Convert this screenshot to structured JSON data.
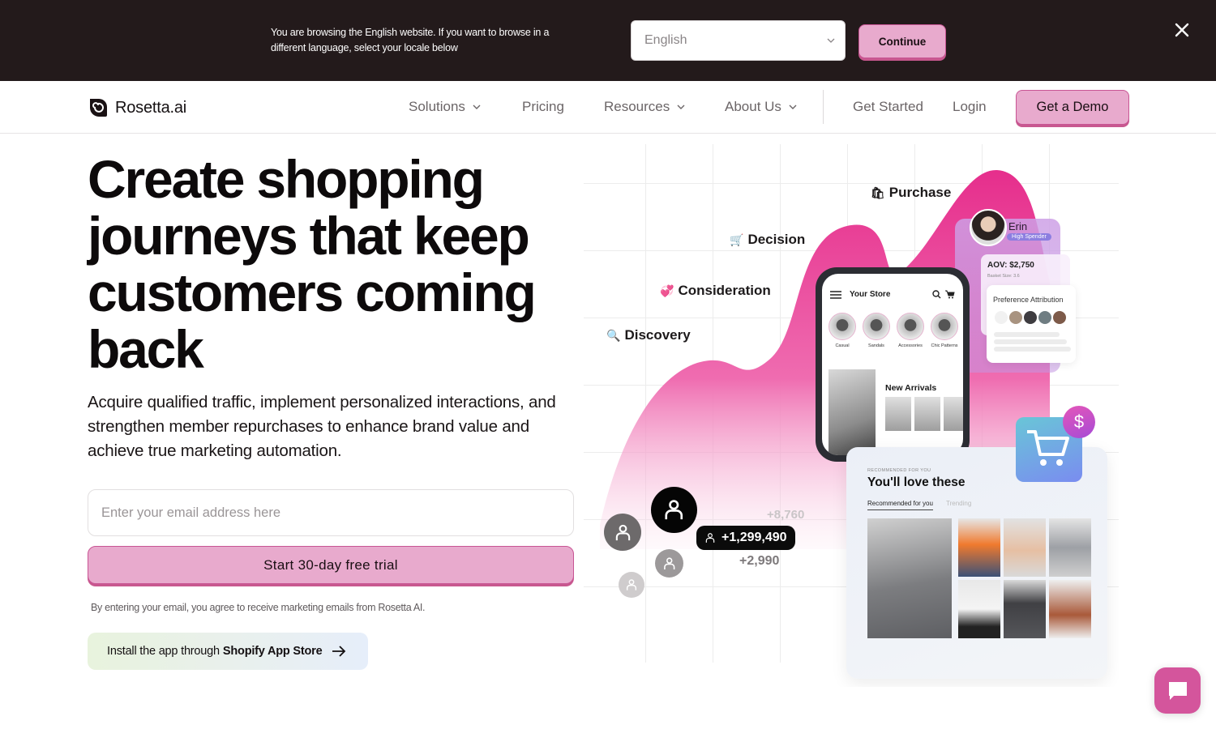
{
  "locale_banner": {
    "message": "You are browsing the English website. If you want to browse in a different language, select your locale below",
    "selected_locale": "English",
    "continue_label": "Continue",
    "close_icon": "close-icon"
  },
  "nav": {
    "brand": "Rosetta.ai",
    "items": [
      {
        "label": "Solutions",
        "dropdown": true
      },
      {
        "label": "Pricing",
        "dropdown": false
      },
      {
        "label": "Resources",
        "dropdown": true
      },
      {
        "label": "About Us",
        "dropdown": true
      }
    ],
    "get_started": "Get Started",
    "login": "Login",
    "demo": "Get a Demo"
  },
  "hero": {
    "title_lines": [
      "Create shopping",
      "journeys that keep",
      "customers coming",
      "back"
    ],
    "subtitle": "Acquire qualified traffic, implement personalized interactions, and strengthen member repurchases to enhance brand value and achieve true marketing automation.",
    "email_placeholder": "Enter your email address here",
    "email_value": "",
    "trial_button": "Start 30-day free trial",
    "consent": "By entering your email, you agree to receive marketing emails from Rosetta AI.",
    "shopify_prefix": "Install the app through",
    "shopify_bold": "Shopify App Store"
  },
  "illustration": {
    "stages": [
      {
        "label": "Discovery",
        "icon": "magnifier-icon",
        "glyph": "🔍"
      },
      {
        "label": "Consideration",
        "icon": "heart-icon",
        "glyph": "💞"
      },
      {
        "label": "Decision",
        "icon": "cart-icon",
        "glyph": "🛒"
      },
      {
        "label": "Purchase",
        "icon": "shopping-bags-icon",
        "glyph": "🛍"
      }
    ],
    "phone": {
      "store_title": "Your Store",
      "categories": [
        "Casual",
        "Sandals",
        "Accessories",
        "Chic Patterns"
      ],
      "section_eyebrow": "RECOMMENDED FOR YOU",
      "section_title": "New Arrivals"
    },
    "profile": {
      "name": "Erin",
      "badge": "High Spender",
      "aov": "AOV: $2,750",
      "basket": "Basket Size: 3.6",
      "preference_title": "Preference Attribution",
      "swatch_colors": [
        "#f1f1f1",
        "#a89380",
        "#3e3c40",
        "#6f7d82",
        "#7d5a49"
      ]
    },
    "recommend": {
      "eyebrow": "RECOMMENDED FOR YOU",
      "title": "You'll love these",
      "tab_active": "Recommended for you",
      "tab_inactive": "Trending"
    },
    "counts": {
      "main": "+1,299,490",
      "secondary": "+8,760",
      "tertiary": "+2,990"
    },
    "dollar_symbol": "$"
  },
  "colors": {
    "accent_pink": "#e8aacd",
    "accent_border": "#c85594",
    "banner_bg": "#231a1b",
    "chat_bg": "#d4559c"
  }
}
